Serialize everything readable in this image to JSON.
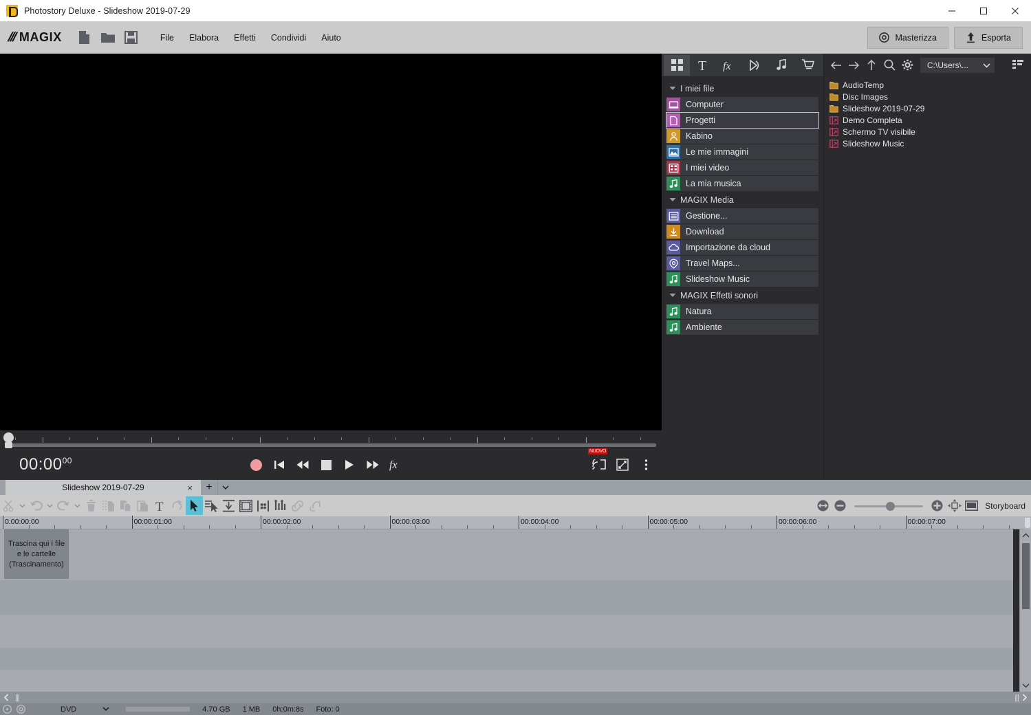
{
  "window": {
    "title": "Photostory Deluxe - Slideshow 2019-07-29",
    "app_icon": "photostory-app-icon",
    "buttons": {
      "minimize": "minimize-icon",
      "maximize": "maximize-icon",
      "close": "close-icon"
    }
  },
  "toolbar": {
    "brand": "MAGIX",
    "brand_slashes": "///",
    "icons": [
      {
        "name": "new-project-icon",
        "label": "new"
      },
      {
        "name": "open-project-icon",
        "label": "open"
      },
      {
        "name": "save-project-icon",
        "label": "save"
      }
    ],
    "menus": [
      "File",
      "Elabora",
      "Effetti",
      "Condividi",
      "Aiuto"
    ],
    "burn_label": "Masterizza",
    "export_label": "Esporta"
  },
  "preview": {
    "background": "#000000"
  },
  "transport": {
    "timecode": "00:00",
    "timecode_frames": "00",
    "buttons": [
      {
        "name": "record-button",
        "glyph": "record"
      },
      {
        "name": "skip-start-button",
        "glyph": "skip-start"
      },
      {
        "name": "rewind-button",
        "glyph": "rewind"
      },
      {
        "name": "stop-button",
        "glyph": "stop"
      },
      {
        "name": "play-button",
        "glyph": "play"
      },
      {
        "name": "fast-forward-button",
        "glyph": "forward"
      },
      {
        "name": "effects-fx-button",
        "glyph": "fx"
      }
    ],
    "cast_badge": "NUOVO",
    "right_buttons": [
      "cast-icon",
      "fullscreen-icon",
      "more-options-icon"
    ]
  },
  "mediapool": {
    "tabs": [
      {
        "name": "tab-media",
        "icon": "grid-icon",
        "active": true
      },
      {
        "name": "tab-titles",
        "icon": "text-t-icon",
        "active": false
      },
      {
        "name": "tab-effects",
        "icon": "fx-icon",
        "active": false
      },
      {
        "name": "tab-transitions",
        "icon": "transition-icon",
        "active": false
      },
      {
        "name": "tab-audio",
        "icon": "music-note-icon",
        "active": false
      },
      {
        "name": "tab-store",
        "icon": "shopping-cart-icon",
        "active": false
      }
    ],
    "tree": [
      {
        "type": "group",
        "label": "I miei file",
        "expanded": true
      },
      {
        "type": "item",
        "label": "Computer",
        "icon": "computer-icon",
        "color": "#a0539f",
        "selected": false
      },
      {
        "type": "item",
        "label": "Progetti",
        "icon": "document-icon",
        "color": "#b05fb0",
        "selected": true
      },
      {
        "type": "item",
        "label": "Kabino",
        "icon": "user-icon",
        "color": "#d09a2b",
        "selected": false
      },
      {
        "type": "item",
        "label": "Le mie immagini",
        "icon": "image-icon",
        "color": "#2e6fa8",
        "selected": false
      },
      {
        "type": "item",
        "label": "I miei video",
        "icon": "film-icon",
        "color": "#a53449",
        "selected": false
      },
      {
        "type": "item",
        "label": "La mia musica",
        "icon": "music-note-icon",
        "color": "#2f8f5b",
        "selected": false
      },
      {
        "type": "group",
        "label": "MAGIX Media",
        "expanded": true
      },
      {
        "type": "item",
        "label": "Gestione...",
        "icon": "archive-icon",
        "color": "#5b5b9e",
        "selected": false
      },
      {
        "type": "item",
        "label": "Download",
        "icon": "download-icon",
        "color": "#d08a1e",
        "selected": false
      },
      {
        "type": "item",
        "label": "Importazione da cloud",
        "icon": "cloud-icon",
        "color": "#5b5b9e",
        "selected": false
      },
      {
        "type": "item",
        "label": "Travel Maps...",
        "icon": "map-pin-icon",
        "color": "#5b5b9e",
        "selected": false
      },
      {
        "type": "item",
        "label": "Slideshow Music",
        "icon": "music-note-icon",
        "color": "#2f8f5b",
        "selected": false
      },
      {
        "type": "group",
        "label": "MAGIX Effetti sonori",
        "expanded": true
      },
      {
        "type": "item",
        "label": "Natura",
        "icon": "music-note-icon",
        "color": "#2f8f5b",
        "selected": false
      },
      {
        "type": "item",
        "label": "Ambiente",
        "icon": "music-note-icon",
        "color": "#2f8f5b",
        "selected": false
      }
    ]
  },
  "filebrowser": {
    "nav": [
      "back-icon",
      "forward-icon",
      "up-icon",
      "search-icon",
      "settings-gear-icon"
    ],
    "path": "C:\\Users\\...",
    "view_toggle": "list-view-icon",
    "entries": [
      {
        "label": "AudioTemp",
        "kind": "folder"
      },
      {
        "label": "Disc Images",
        "kind": "folder"
      },
      {
        "label": "Slideshow 2019-07-29",
        "kind": "folder"
      },
      {
        "label": "Demo Completa",
        "kind": "project"
      },
      {
        "label": "Schermo TV visibile",
        "kind": "project"
      },
      {
        "label": "Slideshow Music",
        "kind": "project"
      }
    ]
  },
  "timeline": {
    "tab_label": "Slideshow 2019-07-29",
    "tab_close": "×",
    "add_tab": "+",
    "tools": [
      {
        "name": "cut-tool",
        "icon": "scissors-icon",
        "state": "dim",
        "caret": true
      },
      {
        "name": "undo-button",
        "icon": "undo-icon",
        "state": "dim",
        "caret": true
      },
      {
        "name": "redo-button",
        "icon": "redo-icon",
        "state": "dim",
        "caret": true
      },
      {
        "name": "delete-button",
        "icon": "trash-icon",
        "state": "dim",
        "caret": false
      },
      {
        "name": "cut-clip-button",
        "icon": "cut-clip-icon",
        "state": "dim",
        "caret": false
      },
      {
        "name": "copy-button",
        "icon": "copy-icon",
        "state": "dim",
        "caret": false
      },
      {
        "name": "paste-button",
        "icon": "paste-icon",
        "state": "dim",
        "caret": false
      },
      {
        "name": "title-button",
        "icon": "text-t-icon",
        "state": "normal",
        "caret": false
      },
      {
        "name": "rotate-button",
        "icon": "rotate-icon",
        "state": "dim",
        "caret": false
      },
      {
        "name": "mouse-mode-selection",
        "icon": "arrow-cursor-icon",
        "state": "active",
        "caret": false
      },
      {
        "name": "mouse-mode-single-object",
        "icon": "single-object-icon",
        "state": "normal",
        "caret": false
      },
      {
        "name": "mouse-mode-curve",
        "icon": "curve-icon",
        "state": "normal",
        "caret": false
      },
      {
        "name": "mouse-mode-preview",
        "icon": "preview-frame-icon",
        "state": "normal",
        "caret": false
      },
      {
        "name": "mouse-mode-stretch",
        "icon": "stretch-icon",
        "state": "normal",
        "caret": false
      },
      {
        "name": "mouse-mode-volume",
        "icon": "volume-curve-icon",
        "state": "normal",
        "caret": false
      },
      {
        "name": "link-objects-button",
        "icon": "link-icon",
        "state": "dim",
        "caret": false
      },
      {
        "name": "unlink-objects-button",
        "icon": "unlink-icon",
        "state": "dim",
        "caret": false
      }
    ],
    "zoom_controls": [
      {
        "name": "zoom-fit-button",
        "icon": "zoom-fit-icon"
      },
      {
        "name": "zoom-out-button",
        "icon": "minus-circle-icon"
      },
      {
        "name": "zoom-in-button",
        "icon": "plus-circle-icon"
      },
      {
        "name": "zoom-all-button",
        "icon": "zoom-all-icon"
      },
      {
        "name": "storyboard-view-button",
        "icon": "storyboard-icon"
      }
    ],
    "storyboard_label": "Storyboard",
    "ruler_labels": [
      "0:00:00:00",
      "00:00:01:00",
      "00:00:02:00",
      "00:00:03:00",
      "00:00:04:00",
      "00:00:05:00",
      "00:00:06:00",
      "00:00:07:00"
    ],
    "dropzone_text": "Trascina qui i file e le cartelle (Trascinamento)"
  },
  "statusbar": {
    "disc_icon": "disc-icon",
    "burn_icon": "burner-icon",
    "media_type": "DVD",
    "capacity": "4.70 GB",
    "used": "1 MB",
    "duration": "0h:0m:8s",
    "photos": "Foto: 0"
  }
}
